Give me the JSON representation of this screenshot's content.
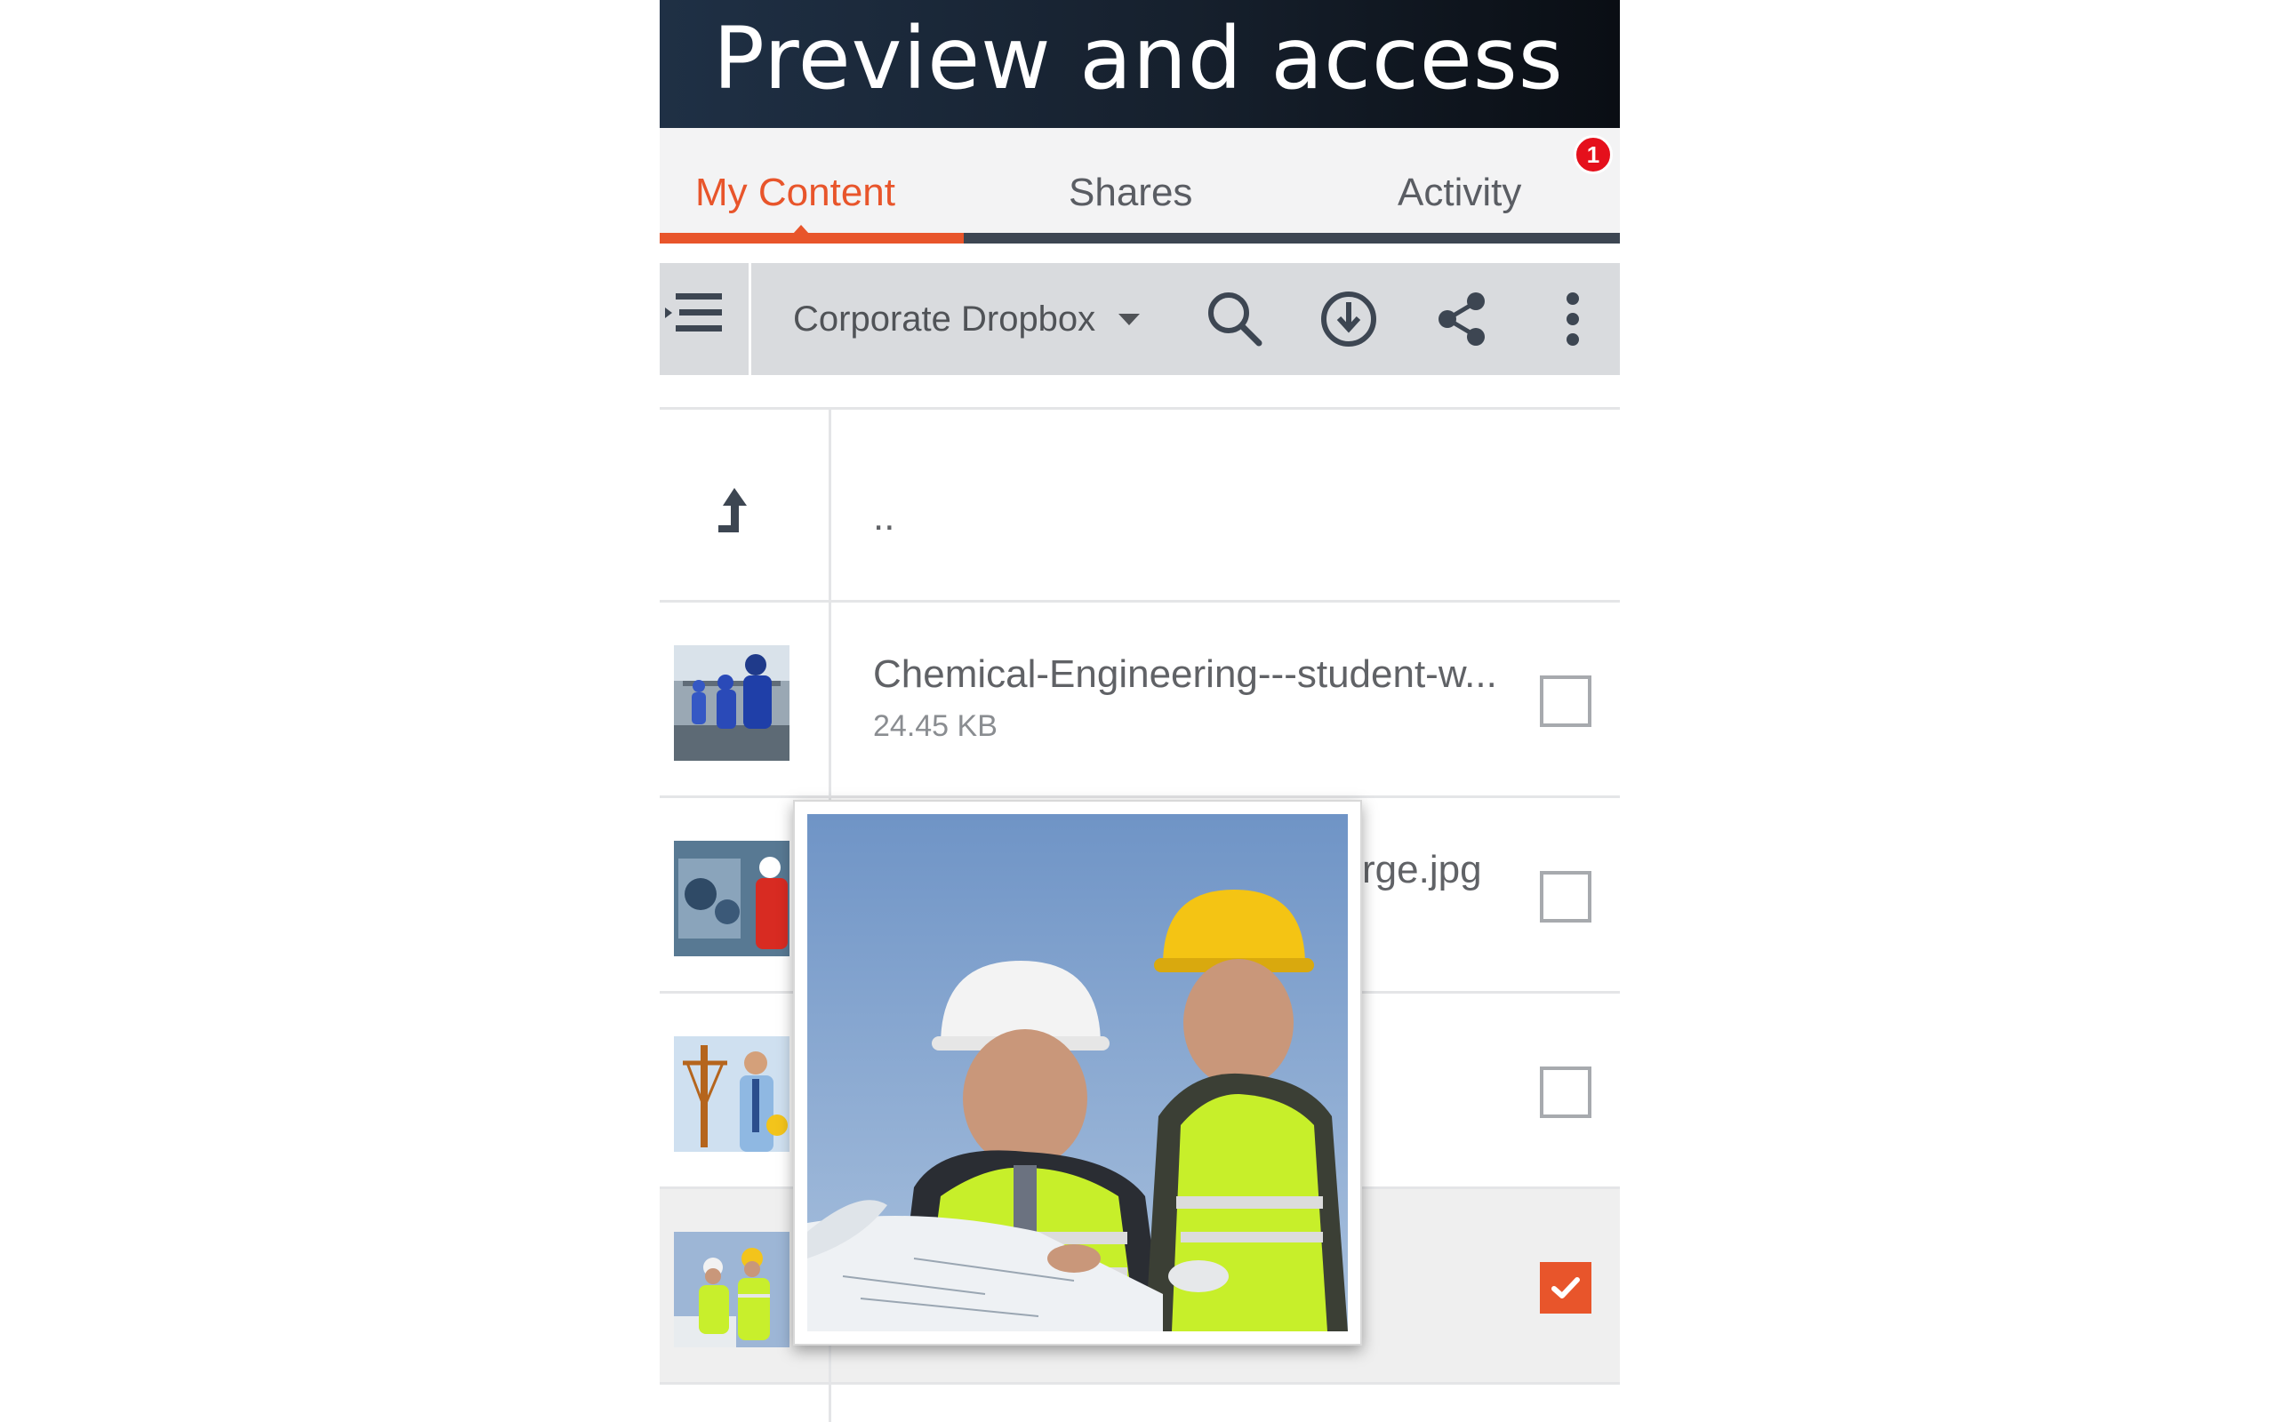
{
  "banner": {
    "title": "Preview and access"
  },
  "tabs": [
    {
      "label": "My Content",
      "active": true
    },
    {
      "label": "Shares",
      "active": false
    },
    {
      "label": "Activity",
      "active": false
    }
  ],
  "notification_badge": "1",
  "toolbar": {
    "location_label": "Corporate Dropbox",
    "icons": [
      "menu-indent-icon",
      "search-icon",
      "download-icon",
      "share-icon",
      "more-vert-icon"
    ]
  },
  "files": [
    {
      "name": "..",
      "size": "",
      "type": "parent-folder"
    },
    {
      "name": "Chemical-Engineering---student-w...",
      "size": "24.45 KB",
      "checked": false
    },
    {
      "name": "rge.jpg",
      "size": "",
      "checked": false
    },
    {
      "name": "",
      "size": "",
      "checked": false
    },
    {
      "name": "",
      "size": "",
      "checked": true
    }
  ],
  "colors": {
    "accent": "#e8552b",
    "badge": "#e5101c",
    "banner": "#1f3045"
  }
}
